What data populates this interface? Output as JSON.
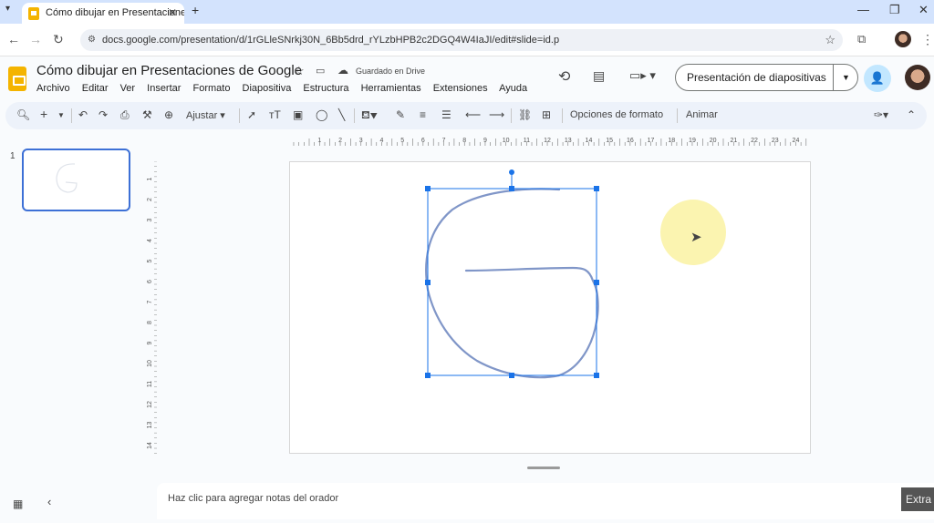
{
  "browser": {
    "tab_title": "Cómo dibujar en Presentacione",
    "new_tab": "+",
    "url": "docs.google.com/presentation/d/1rGLleSNrkj30N_6Bb5drd_rYLzbHPB2c2DGQ4W4IaJI/edit#slide=id.p"
  },
  "doc": {
    "title": "Cómo dibujar en Presentaciones de Google",
    "save_status": "Guardado en Drive",
    "menu": [
      "Archivo",
      "Editar",
      "Ver",
      "Insertar",
      "Formato",
      "Diapositiva",
      "Estructura",
      "Herramientas",
      "Extensiones",
      "Ayuda"
    ],
    "present_button": "Presentación de diapositivas"
  },
  "toolbar": {
    "zoom_label": "Ajustar",
    "format_options": "Opciones de formato",
    "animate": "Animar"
  },
  "filmstrip": {
    "slide_number": "1"
  },
  "ruler": {
    "horizontal_ticks": [
      "1",
      "2",
      "3",
      "4",
      "5",
      "6",
      "7",
      "8",
      "9",
      "10",
      "11",
      "12",
      "13",
      "14",
      "15",
      "16",
      "17",
      "18",
      "19",
      "20",
      "21",
      "22",
      "23",
      "24",
      "25"
    ],
    "vertical_ticks": [
      "1",
      "2",
      "3",
      "4",
      "5",
      "6",
      "7",
      "8",
      "9",
      "10",
      "11",
      "12",
      "13",
      "14"
    ]
  },
  "notes": {
    "placeholder": "Haz clic para agregar notas del orador"
  },
  "overlay": {
    "extra_label": "Extra"
  },
  "colors": {
    "accent": "#1a73e8",
    "tab_strip": "#d3e3fd",
    "slides_brand": "#f4b400",
    "stroke": "#8096c8"
  }
}
